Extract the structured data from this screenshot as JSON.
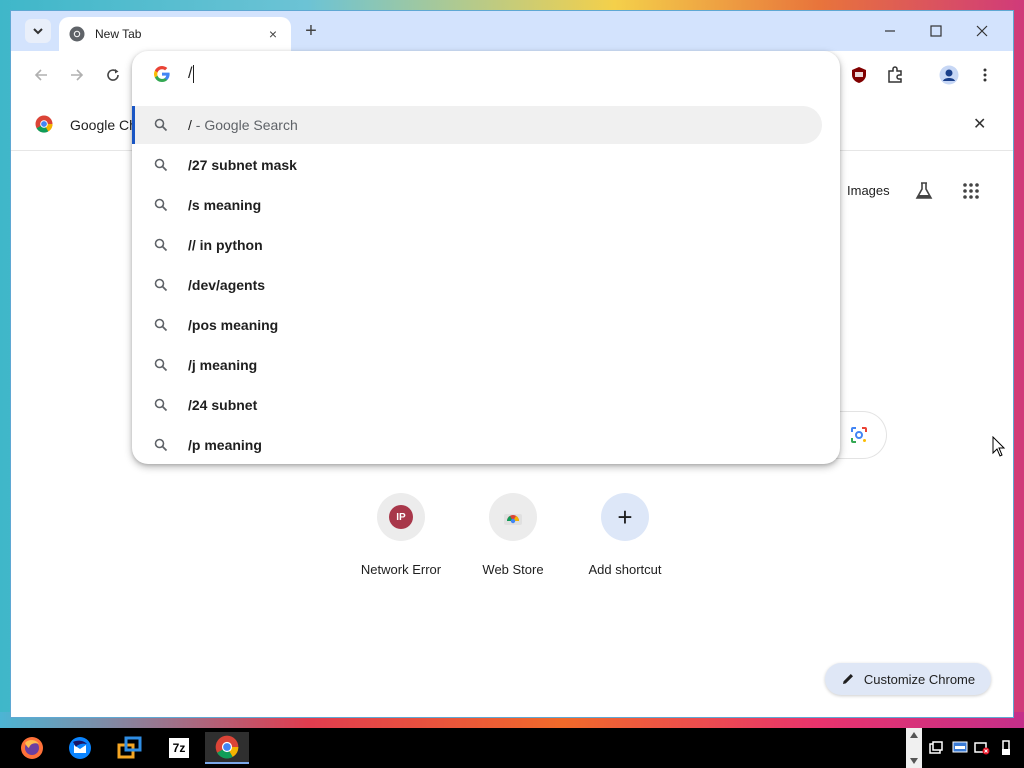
{
  "tab": {
    "title": "New Tab",
    "close": "×"
  },
  "new_tab_symbol": "+",
  "window_controls": {
    "minimize": "—",
    "maximize": "☐",
    "close": "✕"
  },
  "omnibox": {
    "value": "/",
    "suggestions": [
      {
        "bold": "/",
        "suffix": " - Google Search",
        "selected": true
      },
      {
        "bold": "/27 subnet mask",
        "suffix": "",
        "selected": false
      },
      {
        "bold": "/s meaning",
        "suffix": "",
        "selected": false
      },
      {
        "bold": "// in python",
        "suffix": "",
        "selected": false
      },
      {
        "bold": "/dev/agents",
        "suffix": "",
        "selected": false
      },
      {
        "bold": "/pos meaning",
        "suffix": "",
        "selected": false
      },
      {
        "bold": "/j meaning",
        "suffix": "",
        "selected": false
      },
      {
        "bold": "/24 subnet",
        "suffix": "",
        "selected": false
      },
      {
        "bold": "/p meaning",
        "suffix": "",
        "selected": false
      }
    ]
  },
  "infobar": {
    "text": "Google Ch",
    "close": "✕"
  },
  "header_links": {
    "images": "Images"
  },
  "shortcuts": [
    {
      "label": "Network Error",
      "initials": "IP",
      "color": "#a8374a"
    },
    {
      "label": "Web Store"
    },
    {
      "label": "Add shortcut",
      "symbol": "+"
    }
  ],
  "customize": {
    "label": "Customize Chrome"
  },
  "colors": {
    "accent": "#1a56c4",
    "tabstrip": "#d3e3fd",
    "ublock": "#800000"
  },
  "taskbar": {
    "seven_zip": "7z"
  }
}
